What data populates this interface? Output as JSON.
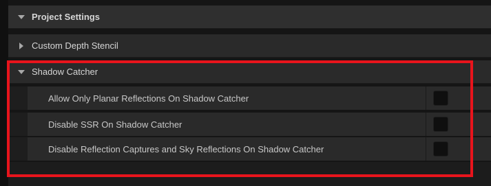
{
  "colors": {
    "highlight": "#e8141c",
    "panel_bg": "#2a2a2a",
    "checkbox_bg": "#0f0f0f"
  },
  "project_settings": {
    "label": "Project Settings",
    "icon": "chevron-down-icon"
  },
  "custom_depth_stencil": {
    "label": "Custom Depth Stencil",
    "icon": "chevron-right-icon"
  },
  "shadow_catcher": {
    "label": "Shadow Catcher",
    "icon": "chevron-down-icon",
    "properties": [
      {
        "label": "Allow Only Planar Reflections On Shadow Catcher",
        "checked": false
      },
      {
        "label": "Disable SSR On Shadow Catcher",
        "checked": false
      },
      {
        "label": "Disable Reflection Captures and Sky Reflections On Shadow Catcher",
        "checked": false
      }
    ]
  }
}
